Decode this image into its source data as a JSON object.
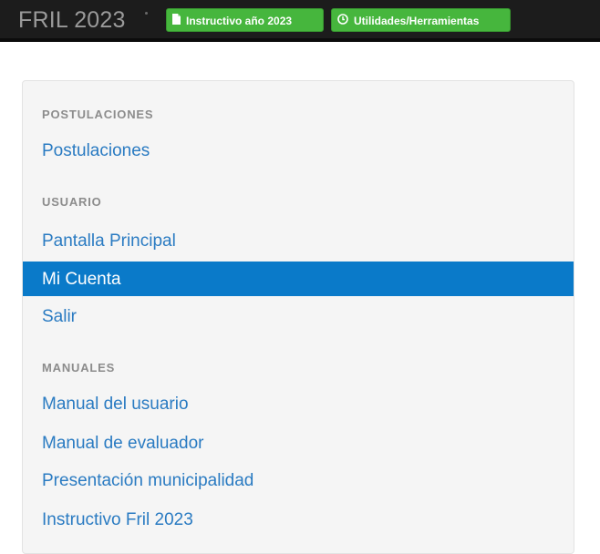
{
  "header": {
    "brand": "FRIL 2023",
    "buttons": [
      {
        "label": "Instructivo año 2023",
        "icon": "file-icon"
      },
      {
        "label": "Utilidades/Herramientas",
        "icon": "clock-icon"
      }
    ],
    "colors": {
      "bar": "#1c1c1c",
      "button": "#46b63d"
    }
  },
  "sidebar": {
    "sections": [
      {
        "title": "POSTULACIONES",
        "items": [
          {
            "label": "Postulaciones"
          }
        ]
      },
      {
        "title": "USUARIO",
        "items": [
          {
            "label": "Pantalla Principal"
          },
          {
            "label": "Mi Cuenta",
            "active": true
          },
          {
            "label": "Salir"
          }
        ]
      },
      {
        "title": "MANUALES",
        "items": [
          {
            "label": "Manual del usuario"
          },
          {
            "label": "Manual de evaluador"
          },
          {
            "label": "Presentación municipalidad"
          },
          {
            "label": "Instructivo Fril 2023"
          }
        ]
      }
    ],
    "colors": {
      "link": "#2a7bc2",
      "active_bg": "#0a7ac9",
      "header": "#8c8c8c",
      "panel_bg": "#f5f5f5"
    }
  }
}
